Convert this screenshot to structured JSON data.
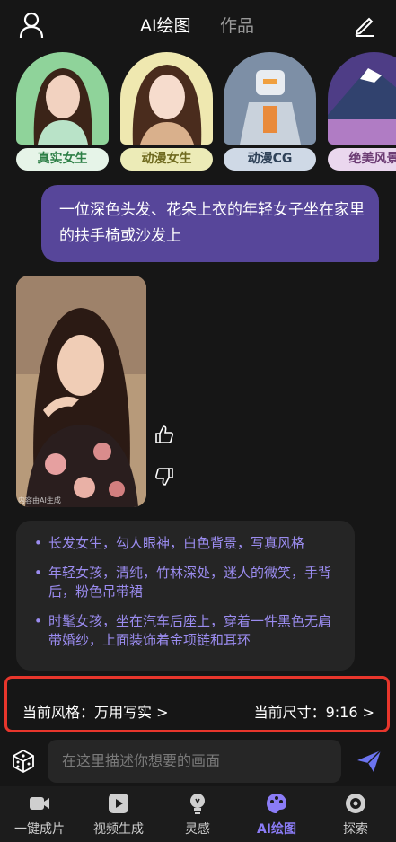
{
  "header": {
    "tab_active": "AI绘图",
    "tab_inactive": "作品"
  },
  "styles": [
    {
      "label": "真实女生",
      "pill_bg": "#e6f4e8",
      "pill_color": "#2d7f46"
    },
    {
      "label": "动漫女生",
      "pill_bg": "#ecebb7",
      "pill_color": "#6f6a1f"
    },
    {
      "label": "动漫CG",
      "pill_bg": "#cfd9e6",
      "pill_color": "#2f4258"
    },
    {
      "label": "绝美风景",
      "pill_bg": "#ead7ee",
      "pill_color": "#6d3d74"
    }
  ],
  "chat": {
    "user_prompt": "一位深色头发、花朵上衣的年轻女子坐在家里的扶手椅或沙发上",
    "watermark": "内容由AI生成"
  },
  "suggestions": [
    "长发女生，勾人眼神，白色背景，写真风格",
    "年轻女孩，清纯，竹林深处，迷人的微笑，手背后，粉色吊带裙",
    "时髦女孩，坐在汽车后座上，穿着一件黑色无肩带婚纱，上面装饰着金项链和耳环"
  ],
  "settings": {
    "style_text": "当前风格：万用写实 >",
    "size_text": "当前尺寸：9:16 >"
  },
  "input": {
    "placeholder": "在这里描述你想要的画面"
  },
  "tabbar": [
    {
      "label": "一键成片",
      "icon": "video-camera-icon"
    },
    {
      "label": "视频生成",
      "icon": "play-icon"
    },
    {
      "label": "灵感",
      "icon": "lightbulb-icon"
    },
    {
      "label": "AI绘图",
      "icon": "palette-icon",
      "active": true
    },
    {
      "label": "探索",
      "icon": "compass-icon"
    }
  ],
  "colors": {
    "accent": "#8b7cf6",
    "user_bubble": "#57469a",
    "highlight_border": "#e8362c"
  }
}
